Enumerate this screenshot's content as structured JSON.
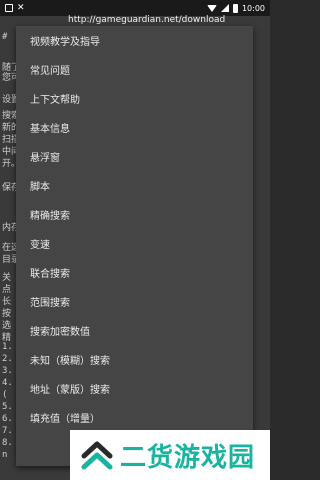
{
  "status": {
    "time": "10:00"
  },
  "url": "http://gameguardian.net/download",
  "background_lines": [
    "#",
    "随了",
    "您可",
    "设置",
    "搜索",
    "新的",
    "扫描",
    "中间",
    "开。",
    "保存",
    "内存",
    "在这",
    "目录",
    "关",
    "点",
    "长",
    "按",
    "选",
    "精",
    "1.",
    "2.",
    "3.",
    "4.",
    "(",
    "5.",
    "6.",
    "7.",
    "8.",
    "n"
  ],
  "menu": {
    "items": [
      "视频教学及指导",
      "常见问题",
      "上下文帮助",
      "基本信息",
      "悬浮窗",
      "脚本",
      "精确搜索",
      "变速",
      "联合搜索",
      "范围搜索",
      "搜索加密数值",
      "未知（模糊）搜索",
      "地址（蒙版）搜索",
      "填充值（增量）"
    ]
  },
  "watermark": {
    "text": "二货游戏园",
    "color": "#19b4a0"
  }
}
